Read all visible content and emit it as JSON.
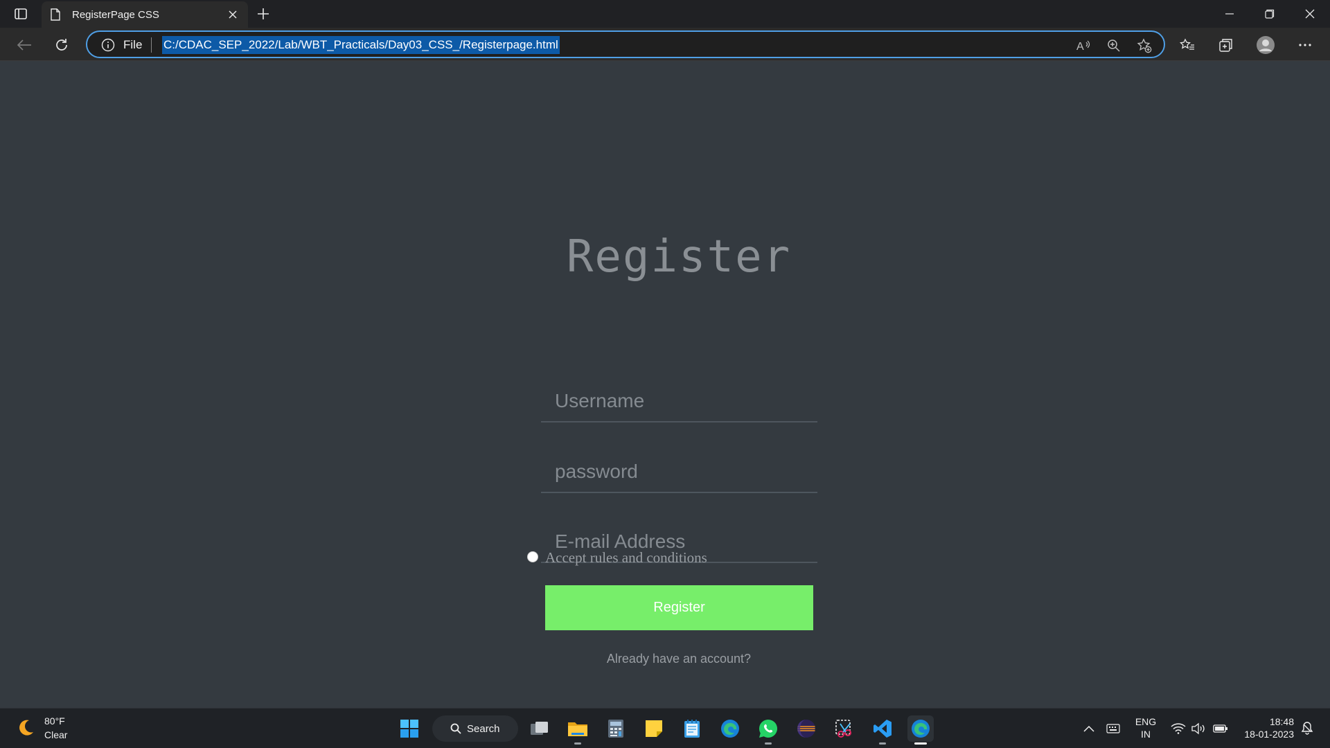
{
  "browser": {
    "tab_title": "RegisterPage CSS",
    "address_prefix": "File",
    "url": "C:/CDAC_SEP_2022/Lab/WBT_Practicals/Day03_CSS_/Registerpage.html"
  },
  "form": {
    "title": "Register",
    "username_placeholder": "Username",
    "password_placeholder": "password",
    "email_placeholder": "E-mail Address",
    "terms_label": "Accept rules and conditions",
    "register_button": "Register",
    "account_link": "Already have an account?"
  },
  "taskbar": {
    "weather_temp": "80°F",
    "weather_condition": "Clear",
    "search_label": "Search",
    "lang_line1": "ENG",
    "lang_line2": "IN",
    "time": "18:48",
    "date": "18-01-2023"
  },
  "colors": {
    "page_bg": "#343a40",
    "register_button_bg": "#77ee6a",
    "address_focus": "#4f9fe6",
    "url_selection": "#0d5aa7"
  },
  "icons": [
    "tab-actions-icon",
    "page-icon",
    "close-icon",
    "plus-icon",
    "minimize-icon",
    "restore-icon",
    "back-arrow-icon",
    "refresh-icon",
    "info-icon",
    "read-aloud-icon",
    "zoom-icon",
    "add-favorite-icon",
    "favorites-icon",
    "collections-icon",
    "profile-icon",
    "more-icon",
    "moon-icon",
    "windows-icon",
    "search-icon",
    "task-view-icon",
    "file-explorer-icon",
    "calculator-icon",
    "sticky-notes-icon",
    "notepad-icon",
    "edge-icon",
    "whatsapp-icon",
    "eclipse-icon",
    "snipping-tool-icon",
    "vscode-icon",
    "chevron-up-icon",
    "keyboard-icon",
    "wifi-icon",
    "volume-icon",
    "battery-icon",
    "notification-icon"
  ]
}
